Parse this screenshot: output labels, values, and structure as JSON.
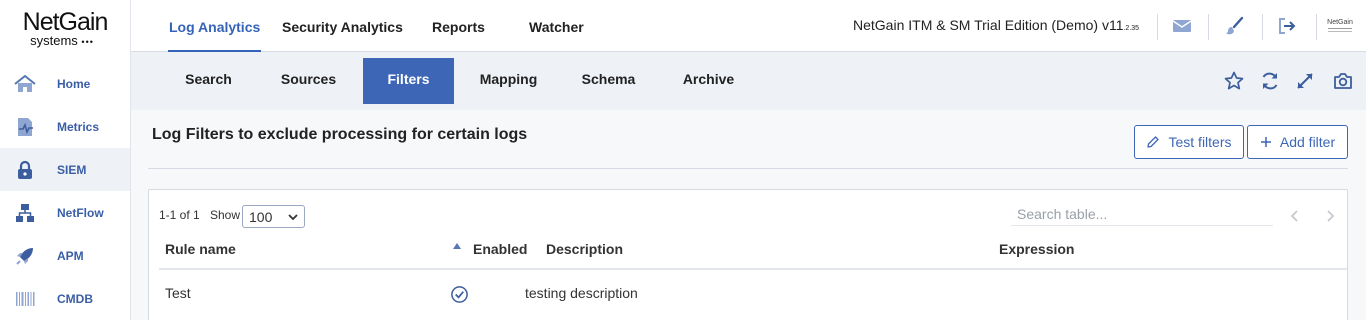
{
  "logo": {
    "name": "NetGain",
    "sub": "systems",
    "dots": "•••"
  },
  "sidebar": {
    "items": [
      {
        "label": "Home",
        "icon": "home-icon"
      },
      {
        "label": "Metrics",
        "icon": "metrics-icon"
      },
      {
        "label": "SIEM",
        "icon": "lock-icon",
        "active": true
      },
      {
        "label": "NetFlow",
        "icon": "network-icon"
      },
      {
        "label": "APM",
        "icon": "rocket-icon"
      },
      {
        "label": "CMDB",
        "icon": "barcode-icon"
      }
    ]
  },
  "topbar": {
    "tabs": [
      {
        "label": "Log Analytics",
        "active": true
      },
      {
        "label": "Security Analytics"
      },
      {
        "label": "Reports"
      },
      {
        "label": "Watcher"
      }
    ],
    "edition": "NetGain ITM & SM Trial Edition (Demo) v11",
    "edition_version": ".2.35",
    "icons": [
      "mail-icon",
      "brush-icon",
      "logout-icon",
      "netgain-logo-icon"
    ],
    "mini_logo_text": "NetGain"
  },
  "subnav": {
    "tabs": [
      {
        "label": "Search"
      },
      {
        "label": "Sources"
      },
      {
        "label": "Filters",
        "active": true
      },
      {
        "label": "Mapping"
      },
      {
        "label": "Schema"
      },
      {
        "label": "Archive"
      }
    ],
    "icons": [
      "star-icon",
      "refresh-icon",
      "expand-icon",
      "camera-icon"
    ]
  },
  "page": {
    "title": "Log Filters to exclude processing for certain logs",
    "test_filters_label": "Test filters",
    "add_filter_label": "Add filter"
  },
  "table": {
    "pager": "1-1 of 1",
    "show_label": "Show",
    "page_size": "100",
    "search_placeholder": "Search table...",
    "columns": {
      "rule_name": "Rule name",
      "enabled": "Enabled",
      "description": "Description",
      "expression": "Expression"
    },
    "rows": [
      {
        "rule_name": "Test",
        "enabled": true,
        "description": "testing description",
        "expression": ""
      }
    ]
  },
  "colors": {
    "accent": "#3d67b6",
    "icon_blue": "#5576b5",
    "subnav_bg": "#eef1f6"
  }
}
